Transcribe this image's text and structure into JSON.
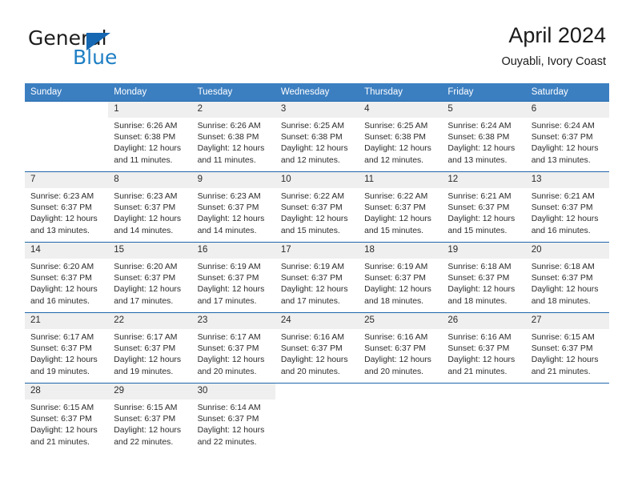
{
  "brand": {
    "line1": "General",
    "line2": "Blue",
    "triangle_color": "#1668b3",
    "blue_text_color": "#1f7fc4"
  },
  "header": {
    "title": "April 2024",
    "location": "Ouyabli, Ivory Coast"
  },
  "theme": {
    "header_bg": "#3c7fc1",
    "row_divider": "#1f66ab",
    "daynum_bg": "#efefef",
    "text": "#2b2b2b"
  },
  "weekdays": [
    "Sunday",
    "Monday",
    "Tuesday",
    "Wednesday",
    "Thursday",
    "Friday",
    "Saturday"
  ],
  "weeks": [
    [
      {
        "day": "",
        "sunrise": "",
        "sunset": "",
        "daylight1": "",
        "daylight2": ""
      },
      {
        "day": "1",
        "sunrise": "Sunrise: 6:26 AM",
        "sunset": "Sunset: 6:38 PM",
        "daylight1": "Daylight: 12 hours",
        "daylight2": "and 11 minutes."
      },
      {
        "day": "2",
        "sunrise": "Sunrise: 6:26 AM",
        "sunset": "Sunset: 6:38 PM",
        "daylight1": "Daylight: 12 hours",
        "daylight2": "and 11 minutes."
      },
      {
        "day": "3",
        "sunrise": "Sunrise: 6:25 AM",
        "sunset": "Sunset: 6:38 PM",
        "daylight1": "Daylight: 12 hours",
        "daylight2": "and 12 minutes."
      },
      {
        "day": "4",
        "sunrise": "Sunrise: 6:25 AM",
        "sunset": "Sunset: 6:38 PM",
        "daylight1": "Daylight: 12 hours",
        "daylight2": "and 12 minutes."
      },
      {
        "day": "5",
        "sunrise": "Sunrise: 6:24 AM",
        "sunset": "Sunset: 6:38 PM",
        "daylight1": "Daylight: 12 hours",
        "daylight2": "and 13 minutes."
      },
      {
        "day": "6",
        "sunrise": "Sunrise: 6:24 AM",
        "sunset": "Sunset: 6:37 PM",
        "daylight1": "Daylight: 12 hours",
        "daylight2": "and 13 minutes."
      }
    ],
    [
      {
        "day": "7",
        "sunrise": "Sunrise: 6:23 AM",
        "sunset": "Sunset: 6:37 PM",
        "daylight1": "Daylight: 12 hours",
        "daylight2": "and 13 minutes."
      },
      {
        "day": "8",
        "sunrise": "Sunrise: 6:23 AM",
        "sunset": "Sunset: 6:37 PM",
        "daylight1": "Daylight: 12 hours",
        "daylight2": "and 14 minutes."
      },
      {
        "day": "9",
        "sunrise": "Sunrise: 6:23 AM",
        "sunset": "Sunset: 6:37 PM",
        "daylight1": "Daylight: 12 hours",
        "daylight2": "and 14 minutes."
      },
      {
        "day": "10",
        "sunrise": "Sunrise: 6:22 AM",
        "sunset": "Sunset: 6:37 PM",
        "daylight1": "Daylight: 12 hours",
        "daylight2": "and 15 minutes."
      },
      {
        "day": "11",
        "sunrise": "Sunrise: 6:22 AM",
        "sunset": "Sunset: 6:37 PM",
        "daylight1": "Daylight: 12 hours",
        "daylight2": "and 15 minutes."
      },
      {
        "day": "12",
        "sunrise": "Sunrise: 6:21 AM",
        "sunset": "Sunset: 6:37 PM",
        "daylight1": "Daylight: 12 hours",
        "daylight2": "and 15 minutes."
      },
      {
        "day": "13",
        "sunrise": "Sunrise: 6:21 AM",
        "sunset": "Sunset: 6:37 PM",
        "daylight1": "Daylight: 12 hours",
        "daylight2": "and 16 minutes."
      }
    ],
    [
      {
        "day": "14",
        "sunrise": "Sunrise: 6:20 AM",
        "sunset": "Sunset: 6:37 PM",
        "daylight1": "Daylight: 12 hours",
        "daylight2": "and 16 minutes."
      },
      {
        "day": "15",
        "sunrise": "Sunrise: 6:20 AM",
        "sunset": "Sunset: 6:37 PM",
        "daylight1": "Daylight: 12 hours",
        "daylight2": "and 17 minutes."
      },
      {
        "day": "16",
        "sunrise": "Sunrise: 6:19 AM",
        "sunset": "Sunset: 6:37 PM",
        "daylight1": "Daylight: 12 hours",
        "daylight2": "and 17 minutes."
      },
      {
        "day": "17",
        "sunrise": "Sunrise: 6:19 AM",
        "sunset": "Sunset: 6:37 PM",
        "daylight1": "Daylight: 12 hours",
        "daylight2": "and 17 minutes."
      },
      {
        "day": "18",
        "sunrise": "Sunrise: 6:19 AM",
        "sunset": "Sunset: 6:37 PM",
        "daylight1": "Daylight: 12 hours",
        "daylight2": "and 18 minutes."
      },
      {
        "day": "19",
        "sunrise": "Sunrise: 6:18 AM",
        "sunset": "Sunset: 6:37 PM",
        "daylight1": "Daylight: 12 hours",
        "daylight2": "and 18 minutes."
      },
      {
        "day": "20",
        "sunrise": "Sunrise: 6:18 AM",
        "sunset": "Sunset: 6:37 PM",
        "daylight1": "Daylight: 12 hours",
        "daylight2": "and 18 minutes."
      }
    ],
    [
      {
        "day": "21",
        "sunrise": "Sunrise: 6:17 AM",
        "sunset": "Sunset: 6:37 PM",
        "daylight1": "Daylight: 12 hours",
        "daylight2": "and 19 minutes."
      },
      {
        "day": "22",
        "sunrise": "Sunrise: 6:17 AM",
        "sunset": "Sunset: 6:37 PM",
        "daylight1": "Daylight: 12 hours",
        "daylight2": "and 19 minutes."
      },
      {
        "day": "23",
        "sunrise": "Sunrise: 6:17 AM",
        "sunset": "Sunset: 6:37 PM",
        "daylight1": "Daylight: 12 hours",
        "daylight2": "and 20 minutes."
      },
      {
        "day": "24",
        "sunrise": "Sunrise: 6:16 AM",
        "sunset": "Sunset: 6:37 PM",
        "daylight1": "Daylight: 12 hours",
        "daylight2": "and 20 minutes."
      },
      {
        "day": "25",
        "sunrise": "Sunrise: 6:16 AM",
        "sunset": "Sunset: 6:37 PM",
        "daylight1": "Daylight: 12 hours",
        "daylight2": "and 20 minutes."
      },
      {
        "day": "26",
        "sunrise": "Sunrise: 6:16 AM",
        "sunset": "Sunset: 6:37 PM",
        "daylight1": "Daylight: 12 hours",
        "daylight2": "and 21 minutes."
      },
      {
        "day": "27",
        "sunrise": "Sunrise: 6:15 AM",
        "sunset": "Sunset: 6:37 PM",
        "daylight1": "Daylight: 12 hours",
        "daylight2": "and 21 minutes."
      }
    ],
    [
      {
        "day": "28",
        "sunrise": "Sunrise: 6:15 AM",
        "sunset": "Sunset: 6:37 PM",
        "daylight1": "Daylight: 12 hours",
        "daylight2": "and 21 minutes."
      },
      {
        "day": "29",
        "sunrise": "Sunrise: 6:15 AM",
        "sunset": "Sunset: 6:37 PM",
        "daylight1": "Daylight: 12 hours",
        "daylight2": "and 22 minutes."
      },
      {
        "day": "30",
        "sunrise": "Sunrise: 6:14 AM",
        "sunset": "Sunset: 6:37 PM",
        "daylight1": "Daylight: 12 hours",
        "daylight2": "and 22 minutes."
      },
      {
        "day": "",
        "sunrise": "",
        "sunset": "",
        "daylight1": "",
        "daylight2": ""
      },
      {
        "day": "",
        "sunrise": "",
        "sunset": "",
        "daylight1": "",
        "daylight2": ""
      },
      {
        "day": "",
        "sunrise": "",
        "sunset": "",
        "daylight1": "",
        "daylight2": ""
      },
      {
        "day": "",
        "sunrise": "",
        "sunset": "",
        "daylight1": "",
        "daylight2": ""
      }
    ]
  ]
}
